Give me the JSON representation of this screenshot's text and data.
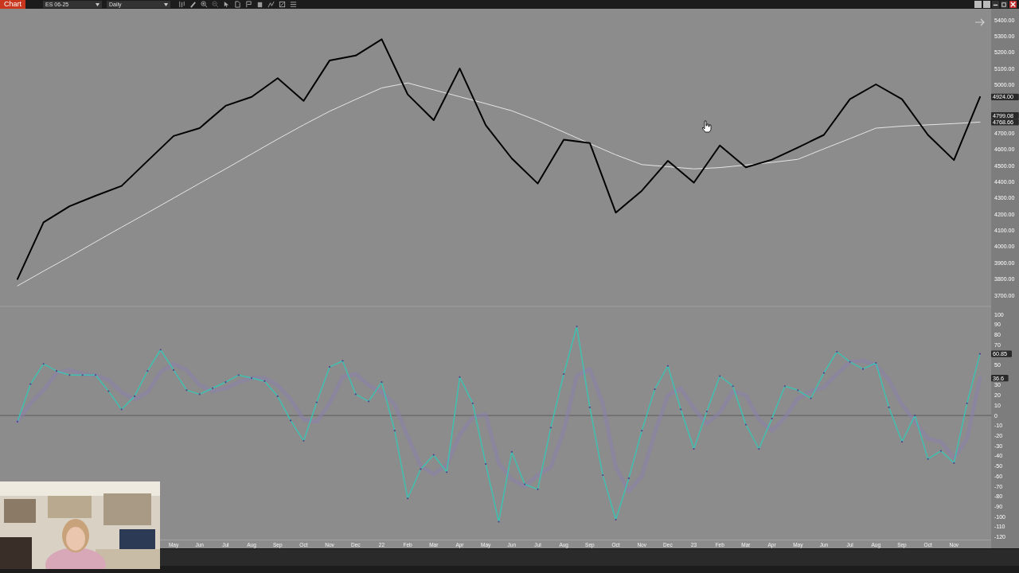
{
  "toolbar": {
    "app_button": "Chart",
    "symbol": "ES 06-25",
    "interval": "Daily"
  },
  "price_panel": {
    "chart_data": {
      "type": "line",
      "ylim": [
        3700,
        5400
      ],
      "categories": [
        null,
        null,
        null,
        null,
        null,
        null,
        null,
        null,
        null,
        null,
        null,
        null,
        null,
        null,
        null,
        null,
        null,
        null,
        null,
        null,
        null,
        null,
        null,
        null,
        null,
        null,
        null,
        null,
        null,
        null,
        null,
        null,
        null,
        null,
        null,
        null,
        null,
        null
      ],
      "series": [
        {
          "color": "#000000",
          "values": [
            3800,
            4150,
            4250,
            4314,
            4375,
            4530,
            4683,
            4732,
            4870,
            4925,
            5040,
            4900,
            5150,
            5180,
            5280,
            4940,
            4781,
            5100,
            4750,
            4545,
            4390,
            4660,
            4640,
            4210,
            4345,
            4530,
            4395,
            4625,
            4490,
            4537,
            4612,
            4690,
            4910,
            5002,
            4910,
            4690,
            4535,
            4924
          ]
        },
        {
          "color": "#e6e6e6",
          "values": [
            3758,
            3849,
            3938,
            4029,
            4120,
            4209,
            4300,
            4391,
            4480,
            4572,
            4664,
            4752,
            4836,
            4909,
            4980,
            5011,
            4968,
            4926,
            4883,
            4839,
            4777,
            4707,
            4636,
            4567,
            4507,
            4494,
            4480,
            4488,
            4504,
            4520,
            4539,
            4604,
            4667,
            4732,
            4744,
            4752,
            4760,
            4769
          ]
        }
      ],
      "yticks": [
        {
          "value": 5400,
          "label": "5400.00"
        },
        {
          "value": 5300,
          "label": "5300.00"
        },
        {
          "value": 5200,
          "label": "5200.00"
        },
        {
          "value": 5100,
          "label": "5100.00"
        },
        {
          "value": 5000,
          "label": "5000.00"
        },
        {
          "value": 4700,
          "label": "4700.00"
        },
        {
          "value": 4600,
          "label": "4600.00"
        },
        {
          "value": 4500,
          "label": "4500.00"
        },
        {
          "value": 4400,
          "label": "4400.00"
        },
        {
          "value": 4300,
          "label": "4300.00"
        },
        {
          "value": 4200,
          "label": "4200.00"
        },
        {
          "value": 4100,
          "label": "4100.00"
        },
        {
          "value": 4000,
          "label": "4000.00"
        },
        {
          "value": 3900,
          "label": "3900.00"
        },
        {
          "value": 3800,
          "label": "3800.00"
        },
        {
          "value": 3700,
          "label": "3700.00"
        }
      ],
      "annotations": [
        "4924.00",
        "4799.08",
        "4768.66"
      ]
    }
  },
  "oscillator_panel": {
    "chart_data": {
      "type": "line",
      "ylim": [
        -120,
        100
      ],
      "categories": [
        null,
        null,
        null,
        null,
        null,
        null,
        null,
        null,
        null,
        null,
        null,
        null,
        "May",
        null,
        "Jun",
        null,
        "Jul",
        null,
        "Aug",
        null,
        "Sep",
        null,
        "Oct",
        null,
        "Nov",
        null,
        "Dec",
        null,
        "22",
        null,
        "Feb",
        null,
        "Mar",
        null,
        "Apr",
        null,
        "May",
        null,
        "Jun",
        null,
        "Jul",
        null,
        "Aug",
        null,
        "Sep",
        null,
        "Oct",
        null,
        "Nov",
        null,
        "Dec",
        null,
        "23",
        null,
        "Feb",
        null,
        "Mar",
        null,
        "Apr",
        null,
        "May",
        null,
        "Jun",
        null,
        "Jul",
        null,
        "Aug",
        null,
        "Sep",
        null,
        "Oct",
        null,
        "Nov",
        null,
        null
      ],
      "series": [
        {
          "color": "#40c0b0",
          "values": [
            -6,
            31,
            51,
            44,
            40,
            40,
            40,
            24,
            6,
            19,
            44,
            65,
            45,
            25,
            21,
            27,
            33,
            40,
            37,
            34,
            19,
            -5,
            -25,
            13,
            48,
            54,
            21,
            14,
            33,
            -15,
            -82,
            -53,
            -39,
            -56,
            38,
            12,
            -48,
            -105,
            -36,
            -68,
            -73,
            -12,
            41,
            88,
            8,
            -59,
            -103,
            -62,
            -15,
            26,
            49,
            6,
            -33,
            4,
            39,
            29,
            -9,
            -33,
            -3,
            29,
            25,
            17,
            42,
            63,
            53,
            46,
            52,
            8,
            -26,
            0,
            -43,
            -35,
            -47,
            12,
            61
          ]
        },
        {
          "color": "#8a80a8",
          "values": [
            -6,
            12,
            25,
            42,
            45,
            41,
            40,
            35,
            23,
            16,
            23,
            43,
            51,
            45,
            30,
            24,
            27,
            33,
            37,
            37,
            30,
            16,
            -4,
            -6,
            12,
            38,
            41,
            30,
            23,
            11,
            -21,
            -50,
            -58,
            -49,
            -19,
            -2,
            1,
            -47,
            -63,
            -70,
            -59,
            -51,
            -15,
            39,
            46,
            12,
            -51,
            -75,
            -60,
            -17,
            20,
            27,
            7,
            -8,
            3,
            24,
            20,
            -4,
            -15,
            -2,
            17,
            24,
            28,
            41,
            53,
            54,
            50,
            35,
            11,
            -6,
            -23,
            -26,
            -42,
            -23,
            37
          ]
        }
      ],
      "yticks": [
        100,
        90,
        80,
        70,
        50,
        30,
        20,
        10,
        0,
        -10,
        -20,
        -30,
        -40,
        -50,
        -60,
        -70,
        -80,
        -90,
        -100,
        -110,
        -120
      ],
      "annotations": [
        "60.85",
        "36.6"
      ]
    }
  }
}
